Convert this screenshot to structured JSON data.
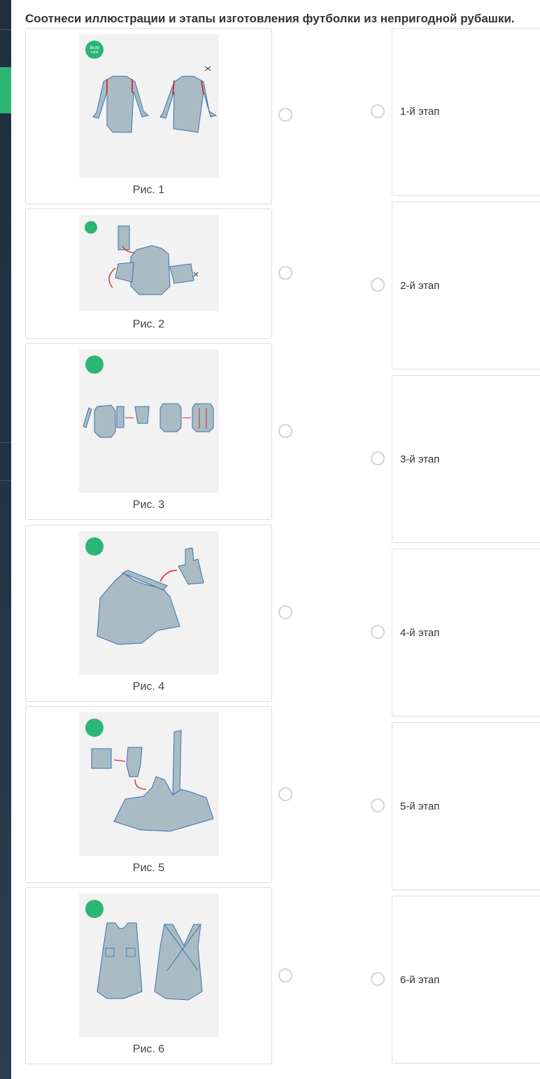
{
  "task": {
    "title": "Соотнеси иллюстрации и этапы изготовления футболки из непригодной рубашки."
  },
  "pictures": [
    {
      "caption": "Рис. 1",
      "icon": "shirt-cut-sleeves-illustration"
    },
    {
      "caption": "Рис. 2",
      "icon": "sleeve-roll-illustration"
    },
    {
      "caption": "Рис. 3",
      "icon": "side-seams-illustration"
    },
    {
      "caption": "Рис. 4",
      "icon": "shoulder-strap-illustration"
    },
    {
      "caption": "Рис. 5",
      "icon": "cross-strap-illustration"
    },
    {
      "caption": "Рис. 6",
      "icon": "finished-top-illustration"
    }
  ],
  "logo": {
    "line1": "BILIM",
    "line2": "Land"
  },
  "stages": [
    {
      "label": "1-й этап"
    },
    {
      "label": "2-й этап"
    },
    {
      "label": "3-й этап"
    },
    {
      "label": "4-й этап"
    },
    {
      "label": "5-й этап"
    },
    {
      "label": "6-й этап"
    }
  ],
  "colors": {
    "accent": "#2bb673",
    "fabric": "#a9bcc4",
    "outline": "#3a6fb0",
    "cut": "#d12a2a"
  }
}
